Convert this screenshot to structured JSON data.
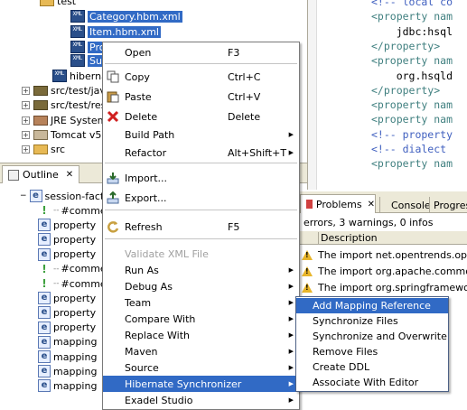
{
  "tree": {
    "top_item": "test",
    "items": [
      {
        "label": "Category.hbm.xml"
      },
      {
        "label": "Item.hbm.xml"
      },
      {
        "label": "Prod"
      },
      {
        "label": "Sup"
      },
      {
        "label": "hibernat"
      },
      {
        "label": "src/test/jav"
      },
      {
        "label": "src/test/res"
      },
      {
        "label": "JRE System"
      },
      {
        "label": "Tomcat v5."
      },
      {
        "label": "src"
      }
    ]
  },
  "outline": {
    "tab": "Outline",
    "root": "session-fact",
    "items": [
      {
        "kind": "comment",
        "label": "#comme"
      },
      {
        "kind": "element",
        "label": "property"
      },
      {
        "kind": "element",
        "label": "property"
      },
      {
        "kind": "element",
        "label": "property"
      },
      {
        "kind": "comment",
        "label": "#comme"
      },
      {
        "kind": "comment",
        "label": "#comme"
      },
      {
        "kind": "element",
        "label": "property"
      },
      {
        "kind": "element",
        "label": "property"
      },
      {
        "kind": "element",
        "label": "property"
      },
      {
        "kind": "element",
        "label": "mapping"
      },
      {
        "kind": "element",
        "label": "mapping"
      },
      {
        "kind": "element",
        "label": "mapping"
      },
      {
        "kind": "element",
        "label": "mapping"
      }
    ]
  },
  "editor": {
    "lines": [
      {
        "text": "<!-- local co",
        "kind": "comment"
      },
      {
        "text": "<property nam",
        "kind": "tag"
      },
      {
        "text": "    jdbc:hsql",
        "kind": "text"
      },
      {
        "text": "</property>",
        "kind": "tag"
      },
      {
        "text": "<property nam",
        "kind": "tag"
      },
      {
        "text": "    org.hsqld",
        "kind": "text"
      },
      {
        "text": "</property>",
        "kind": "tag"
      },
      {
        "text": "<property nam",
        "kind": "tag"
      },
      {
        "text": "<property nam",
        "kind": "tag"
      },
      {
        "text": "<!-- property",
        "kind": "comment"
      },
      {
        "text": "<!-- dialect",
        "kind": "comment"
      },
      {
        "text": "<property nam",
        "kind": "tag"
      }
    ]
  },
  "problems": {
    "tabs": [
      {
        "label": "Problems"
      },
      {
        "label": "Console"
      },
      {
        "label": "Progres"
      }
    ],
    "summary": "errors, 3 warnings, 0 infos",
    "column": "Description",
    "rows": [
      {
        "text": "The import net.opentrends.openfr"
      },
      {
        "text": "The import org.apache.commons."
      },
      {
        "text": "The import org.springframework.v"
      }
    ]
  },
  "context_menu": {
    "items": [
      {
        "label": "Open",
        "shortcut": "F3"
      },
      {
        "label": "Copy",
        "shortcut": "Ctrl+C",
        "icon": "copy-icon"
      },
      {
        "label": "Paste",
        "shortcut": "Ctrl+V",
        "icon": "paste-icon"
      },
      {
        "label": "Delete",
        "shortcut": "Delete",
        "icon": "delete-icon"
      },
      {
        "label": "Build Path",
        "submenu": true
      },
      {
        "label": "Refactor",
        "shortcut": "Alt+Shift+T",
        "submenu": true
      },
      {
        "label": "Import...",
        "icon": "import-icon"
      },
      {
        "label": "Export...",
        "icon": "export-icon"
      },
      {
        "label": "Refresh",
        "shortcut": "F5",
        "icon": "refresh-icon"
      },
      {
        "label": "Validate XML File",
        "disabled": true
      },
      {
        "label": "Run As",
        "submenu": true
      },
      {
        "label": "Debug As",
        "submenu": true
      },
      {
        "label": "Team",
        "submenu": true
      },
      {
        "label": "Compare With",
        "submenu": true
      },
      {
        "label": "Replace With",
        "submenu": true
      },
      {
        "label": "Maven",
        "submenu": true
      },
      {
        "label": "Source",
        "submenu": true
      },
      {
        "label": "Hibernate Synchronizer",
        "submenu": true,
        "highlighted": true
      },
      {
        "label": "Exadel Studio",
        "submenu": true
      }
    ]
  },
  "submenu": {
    "items": [
      {
        "label": "Add Mapping Reference",
        "highlighted": true
      },
      {
        "label": "Synchronize Files"
      },
      {
        "label": "Synchronize and Overwrite"
      },
      {
        "label": "Remove Files"
      },
      {
        "label": "Create DDL"
      },
      {
        "label": "Associate With Editor"
      }
    ]
  },
  "colors": {
    "selection": "#316ac5",
    "panel_bg": "#ece9d8",
    "accent": "#2a4f8a"
  }
}
